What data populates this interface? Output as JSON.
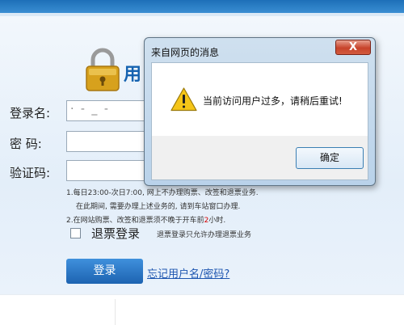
{
  "page": {
    "title_partial": "用",
    "username_label": "登录名:",
    "username_value": "· ‐ _  ‐",
    "password_label": "密   码:",
    "captcha_label": "验证码:",
    "notice_line1": "1.每日23:00-次日7:00, 网上不办理购票、改签和退票业务.",
    "notice_line2": "在此期间, 需要办理上述业务的, 请到车站窗口办理.",
    "notice_line3_prefix": "2.在网站购票、改签和退票须不晚于开车前",
    "notice_line3_num": "2",
    "notice_line3_suffix": "小时.",
    "refund_label": "退票登录",
    "refund_hint": "退票登录只允许办理退票业务",
    "login_button": "登录",
    "forgot_link": "忘记用户名/密码?"
  },
  "dialog": {
    "title": "来自网页的消息",
    "close_symbol": "X",
    "message": "当前访问用户过多，请稍后重试!",
    "ok_button": "确定"
  }
}
